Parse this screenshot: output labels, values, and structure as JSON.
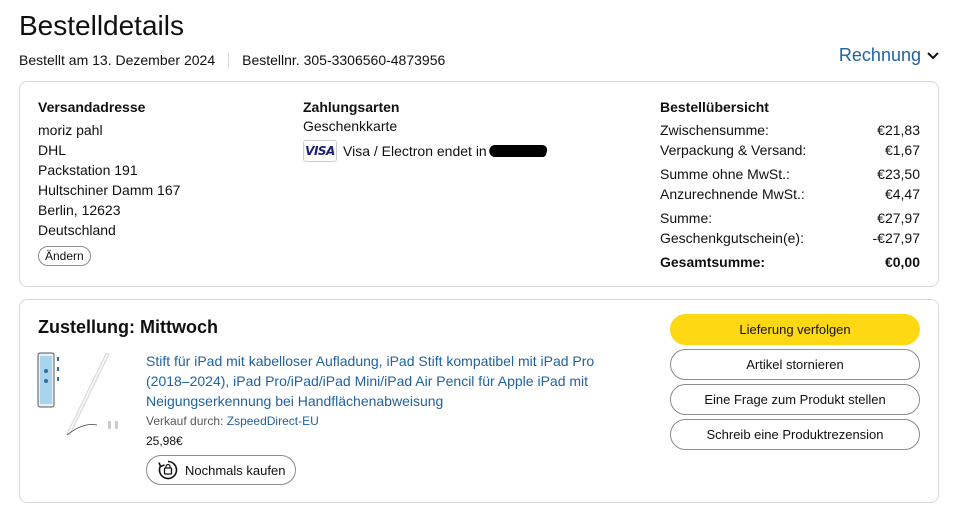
{
  "header": {
    "title": "Bestelldetails",
    "ordered_on": "Bestellt am 13. Dezember 2024",
    "order_number": "Bestellnr. 305-3306560-4873956",
    "invoice_label": "Rechnung"
  },
  "shipping": {
    "heading": "Versandadresse",
    "lines": [
      "moriz pahl",
      "DHL",
      "Packstation 191",
      "Hultschiner Damm 167",
      "Berlin, 12623",
      "Deutschland"
    ],
    "change_label": "Ändern"
  },
  "payment": {
    "heading": "Zahlungsarten",
    "gift_card": "Geschenkkarte",
    "card_logo": "VISA",
    "card_text": "Visa / Electron endet in"
  },
  "summary": {
    "heading": "Bestellübersicht",
    "rows": [
      {
        "label": "Zwischensumme:",
        "value": "€21,83"
      },
      {
        "label": "Verpackung & Versand:",
        "value": "€1,67"
      },
      {
        "label": "Summe ohne MwSt.:",
        "value": "€23,50"
      },
      {
        "label": "Anzurechnende MwSt.:",
        "value": "€4,47"
      },
      {
        "label": "Summe:",
        "value": "€27,97"
      },
      {
        "label": "Geschenkgutschein(e):",
        "value": "-€27,97"
      },
      {
        "label": "Gesamtsumme:",
        "value": "€0,00"
      }
    ]
  },
  "delivery": {
    "title": "Zustellung: Mittwoch",
    "product_title": "Stift für iPad mit kabelloser Aufladung, iPad Stift kompatibel mit iPad Pro (2018–2024), iPad Pro/iPad/iPad Mini/iPad Air Pencil für Apple iPad mit Neigungserkennung bei Handflächenabweisung",
    "seller_prefix": "Verkauf durch:",
    "seller_name": "ZspeedDirect-EU",
    "price": "25,98€",
    "rebuy_label": "Nochmals kaufen",
    "actions": {
      "track": "Lieferung verfolgen",
      "cancel": "Artikel stornieren",
      "question": "Eine Frage zum Produkt stellen",
      "review": "Schreib eine Produktrezension"
    }
  },
  "colors": {
    "link": "#2162a1",
    "primary_button": "#ffd814",
    "border": "#d5d9d9"
  }
}
